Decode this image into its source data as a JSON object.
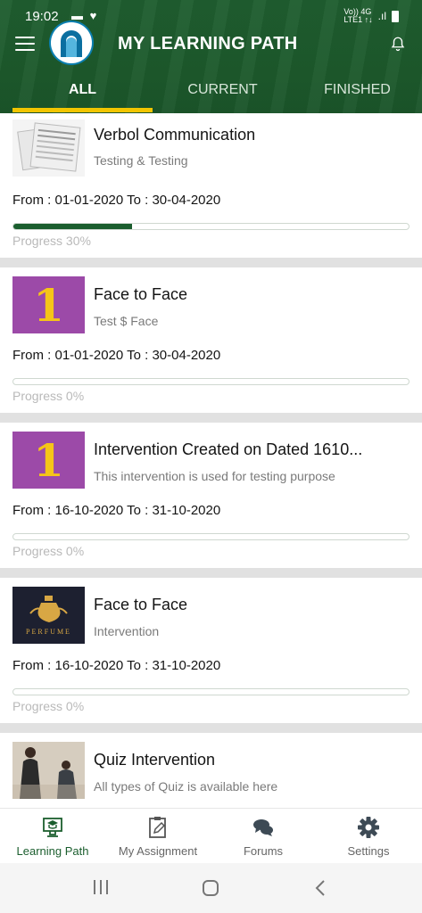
{
  "status_bar": {
    "time": "19:02",
    "network_top": "Vo)) 4G",
    "network_bottom": "LTE1 ↑↓"
  },
  "app": {
    "title": "MY LEARNING PATH"
  },
  "tabs": [
    {
      "label": "ALL",
      "active": true
    },
    {
      "label": "CURRENT",
      "active": false
    },
    {
      "label": "FINISHED",
      "active": false
    }
  ],
  "courses": [
    {
      "title": "Verbol Communication",
      "subtitle": "Testing & Testing",
      "dates": "From : 01-01-2020 To : 30-04-2020",
      "progress": 30,
      "progress_label": "Progress 30%",
      "thumbnail": "newspaper"
    },
    {
      "title": "Face to Face",
      "subtitle": "Test $ Face",
      "dates": "From : 01-01-2020 To : 30-04-2020",
      "progress": 0,
      "progress_label": "Progress 0%",
      "thumbnail": "number",
      "thumb_number": "1"
    },
    {
      "title": "Intervention Created on Dated 1610...",
      "subtitle": "This intervention is used for testing purpose",
      "dates": "From : 16-10-2020 To : 31-10-2020",
      "progress": 0,
      "progress_label": "Progress 0%",
      "thumbnail": "number",
      "thumb_number": "1"
    },
    {
      "title": "Face to Face",
      "subtitle": "Intervention",
      "dates": "From : 16-10-2020 To : 31-10-2020",
      "progress": 0,
      "progress_label": "Progress 0%",
      "thumbnail": "perfume",
      "thumb_text": "PERFUME"
    },
    {
      "title": "Quiz Intervention",
      "subtitle": "All types of Quiz is available here",
      "thumbnail": "people"
    }
  ],
  "bottom_nav": [
    {
      "label": "Learning Path",
      "icon": "learning-path-icon",
      "active": true
    },
    {
      "label": "My Assignment",
      "icon": "assignment-icon",
      "active": false
    },
    {
      "label": "Forums",
      "icon": "forums-icon",
      "active": false
    },
    {
      "label": "Settings",
      "icon": "gear-icon",
      "active": false
    }
  ],
  "colors": {
    "primary": "#1b5e2e",
    "accent": "#f2c500",
    "thumb_purple": "#9c4aa8"
  }
}
